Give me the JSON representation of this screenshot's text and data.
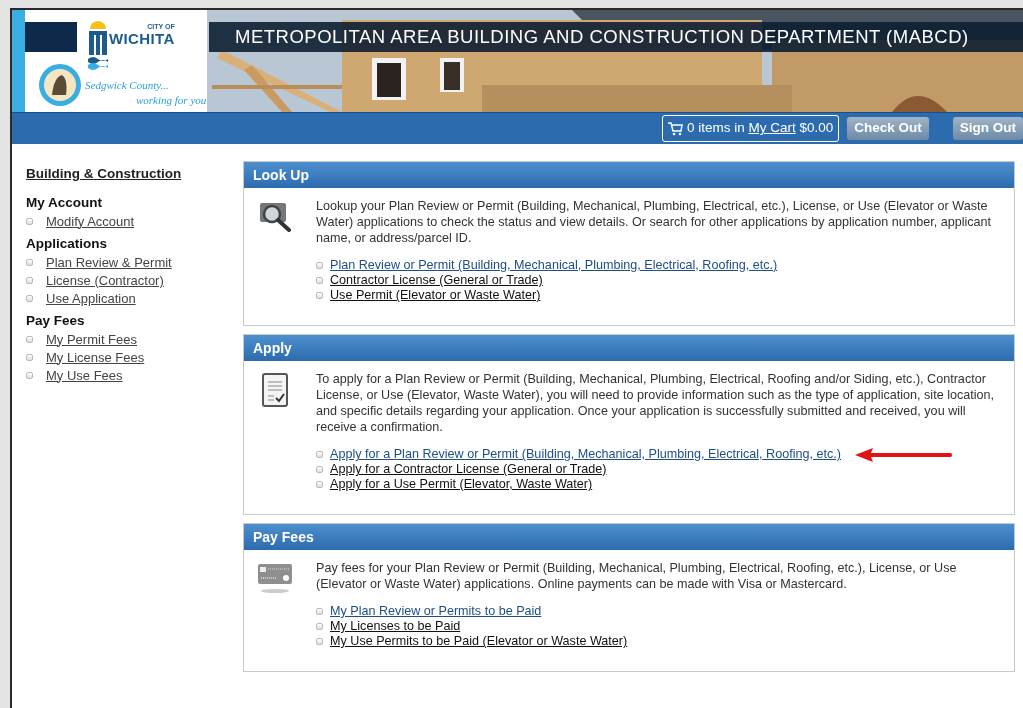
{
  "header": {
    "logo": {
      "city_of": "CITY OF",
      "city": "WICHITA",
      "county": "Sedgwick County...",
      "tagline": "working for you"
    },
    "title": "METROPOLITAN AREA BUILDING AND CONSTRUCTION DEPARTMENT (MABCD)"
  },
  "toolbar": {
    "cart": {
      "count_text": "0 items in",
      "link": "My Cart",
      "total": "$0.00"
    },
    "buttons": [
      "Check Out",
      "Sign Out"
    ]
  },
  "sidebar": {
    "title": "Building & Construction",
    "groups": [
      {
        "heading": "My Account",
        "items": [
          "Modify Account"
        ]
      },
      {
        "heading": "Applications",
        "items": [
          "Plan Review & Permit",
          "License (Contractor)",
          "Use Application"
        ]
      },
      {
        "heading": "Pay Fees",
        "items": [
          "My Permit Fees",
          "My License Fees",
          "My Use Fees"
        ]
      }
    ]
  },
  "sections": [
    {
      "title": "Look Up",
      "kind": "lookup",
      "text": "Lookup your Plan Review or Permit (Building, Mechanical, Plumbing, Electrical, etc.), License, or Use (Elevator or Waste Water) applications to check the status and view details. Or search for other applications by application number, applicant name, or address/parcel ID.",
      "links": [
        {
          "label": "Plan Review or Permit (Building, Mechanical, Plumbing, Electrical, Roofing, etc.)",
          "visited": true,
          "marked": false
        },
        {
          "label": "Contractor License (General or Trade)",
          "visited": false,
          "marked": false
        },
        {
          "label": "Use Permit (Elevator or Waste Water)",
          "visited": false,
          "marked": false
        }
      ]
    },
    {
      "title": "Apply",
      "kind": "apply",
      "text": "To apply for a Plan Review or Permit (Building, Mechanical, Plumbing, Electrical, Roofing and/or Siding, etc.), Contractor License, or Use (Elevator, Waste Water), you will need to provide information such as the type of application, site location, and specific details regarding your application. Once your application is successfully submitted and received, you will receive a confirmation.",
      "links": [
        {
          "label": "Apply for a Plan Review or Permit (Building, Mechanical, Plumbing, Electrical, Roofing, etc.)",
          "visited": true,
          "marked": true
        },
        {
          "label": "Apply for a Contractor License (General or Trade)",
          "visited": false,
          "marked": false
        },
        {
          "label": "Apply for a Use Permit (Elevator, Waste Water)",
          "visited": false,
          "marked": false
        }
      ]
    },
    {
      "title": "Pay Fees",
      "kind": "pay",
      "text": "Pay fees for your Plan Review or Permit (Building, Mechanical, Plumbing, Electrical, Roofing, etc.), License, or Use (Elevator or Waste Water) applications. Online payments can be made with Visa or Mastercard.",
      "links": [
        {
          "label": "My Plan Review or Permits to be Paid",
          "visited": true,
          "marked": false
        },
        {
          "label": "My Licenses to be Paid",
          "visited": false,
          "marked": false
        },
        {
          "label": "My Use Permits to be Paid (Elevator or Waste Water)",
          "visited": false,
          "marked": false
        }
      ]
    }
  ]
}
